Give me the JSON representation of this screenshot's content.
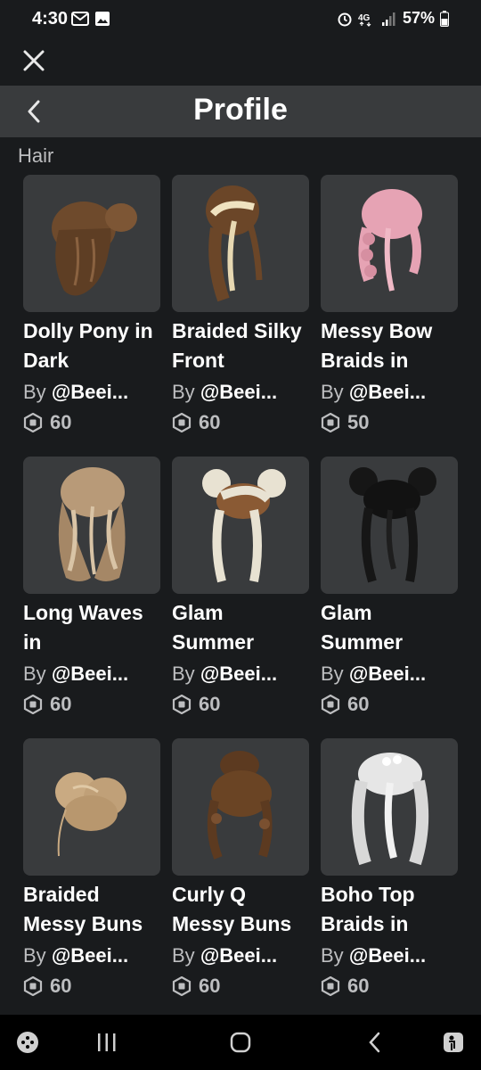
{
  "status_bar": {
    "time": "4:30",
    "battery": "57%"
  },
  "header": {
    "title": "Profile"
  },
  "section": {
    "title": "Hair"
  },
  "colors": {
    "background": "#191b1d",
    "header": "#393b3d",
    "card": "#393b3d",
    "muted_text": "#bdbec0"
  },
  "items": [
    {
      "name": "Dolly Pony in Dark",
      "by": "By",
      "creator": "@Beei...",
      "price": "60",
      "hair_color": "#6e4a2c"
    },
    {
      "name": "Braided Silky Front",
      "by": "By",
      "creator": "@Beei...",
      "price": "60",
      "hair_color": "#7a5232"
    },
    {
      "name": "Messy Bow Braids in",
      "by": "By",
      "creator": "@Beei...",
      "price": "50",
      "hair_color": "#e6a3b4"
    },
    {
      "name": "Long Waves in",
      "by": "By",
      "creator": "@Beei...",
      "price": "60",
      "hair_color": "#b89a78"
    },
    {
      "name": "Glam Summer",
      "by": "By",
      "creator": "@Beei...",
      "price": "60",
      "hair_color": "#e8e2d2"
    },
    {
      "name": "Glam Summer",
      "by": "By",
      "creator": "@Beei...",
      "price": "60",
      "hair_color": "#161616"
    },
    {
      "name": "Braided Messy Buns",
      "by": "By",
      "creator": "@Beei...",
      "price": "60",
      "hair_color": "#c9aa82"
    },
    {
      "name": "Curly Q Messy Buns",
      "by": "By",
      "creator": "@Beei...",
      "price": "60",
      "hair_color": "#5c3a20"
    },
    {
      "name": "Boho Top Braids in",
      "by": "By",
      "creator": "@Beei...",
      "price": "60",
      "hair_color": "#e6e6e6"
    }
  ],
  "icons": {
    "close": "close-icon",
    "back": "chevron-left-icon",
    "currency": "robux-icon",
    "nav_game": "game-launcher-icon",
    "nav_recents": "recent-apps-icon",
    "nav_home": "home-icon",
    "nav_back": "back-icon",
    "nav_assist": "accessibility-icon"
  }
}
